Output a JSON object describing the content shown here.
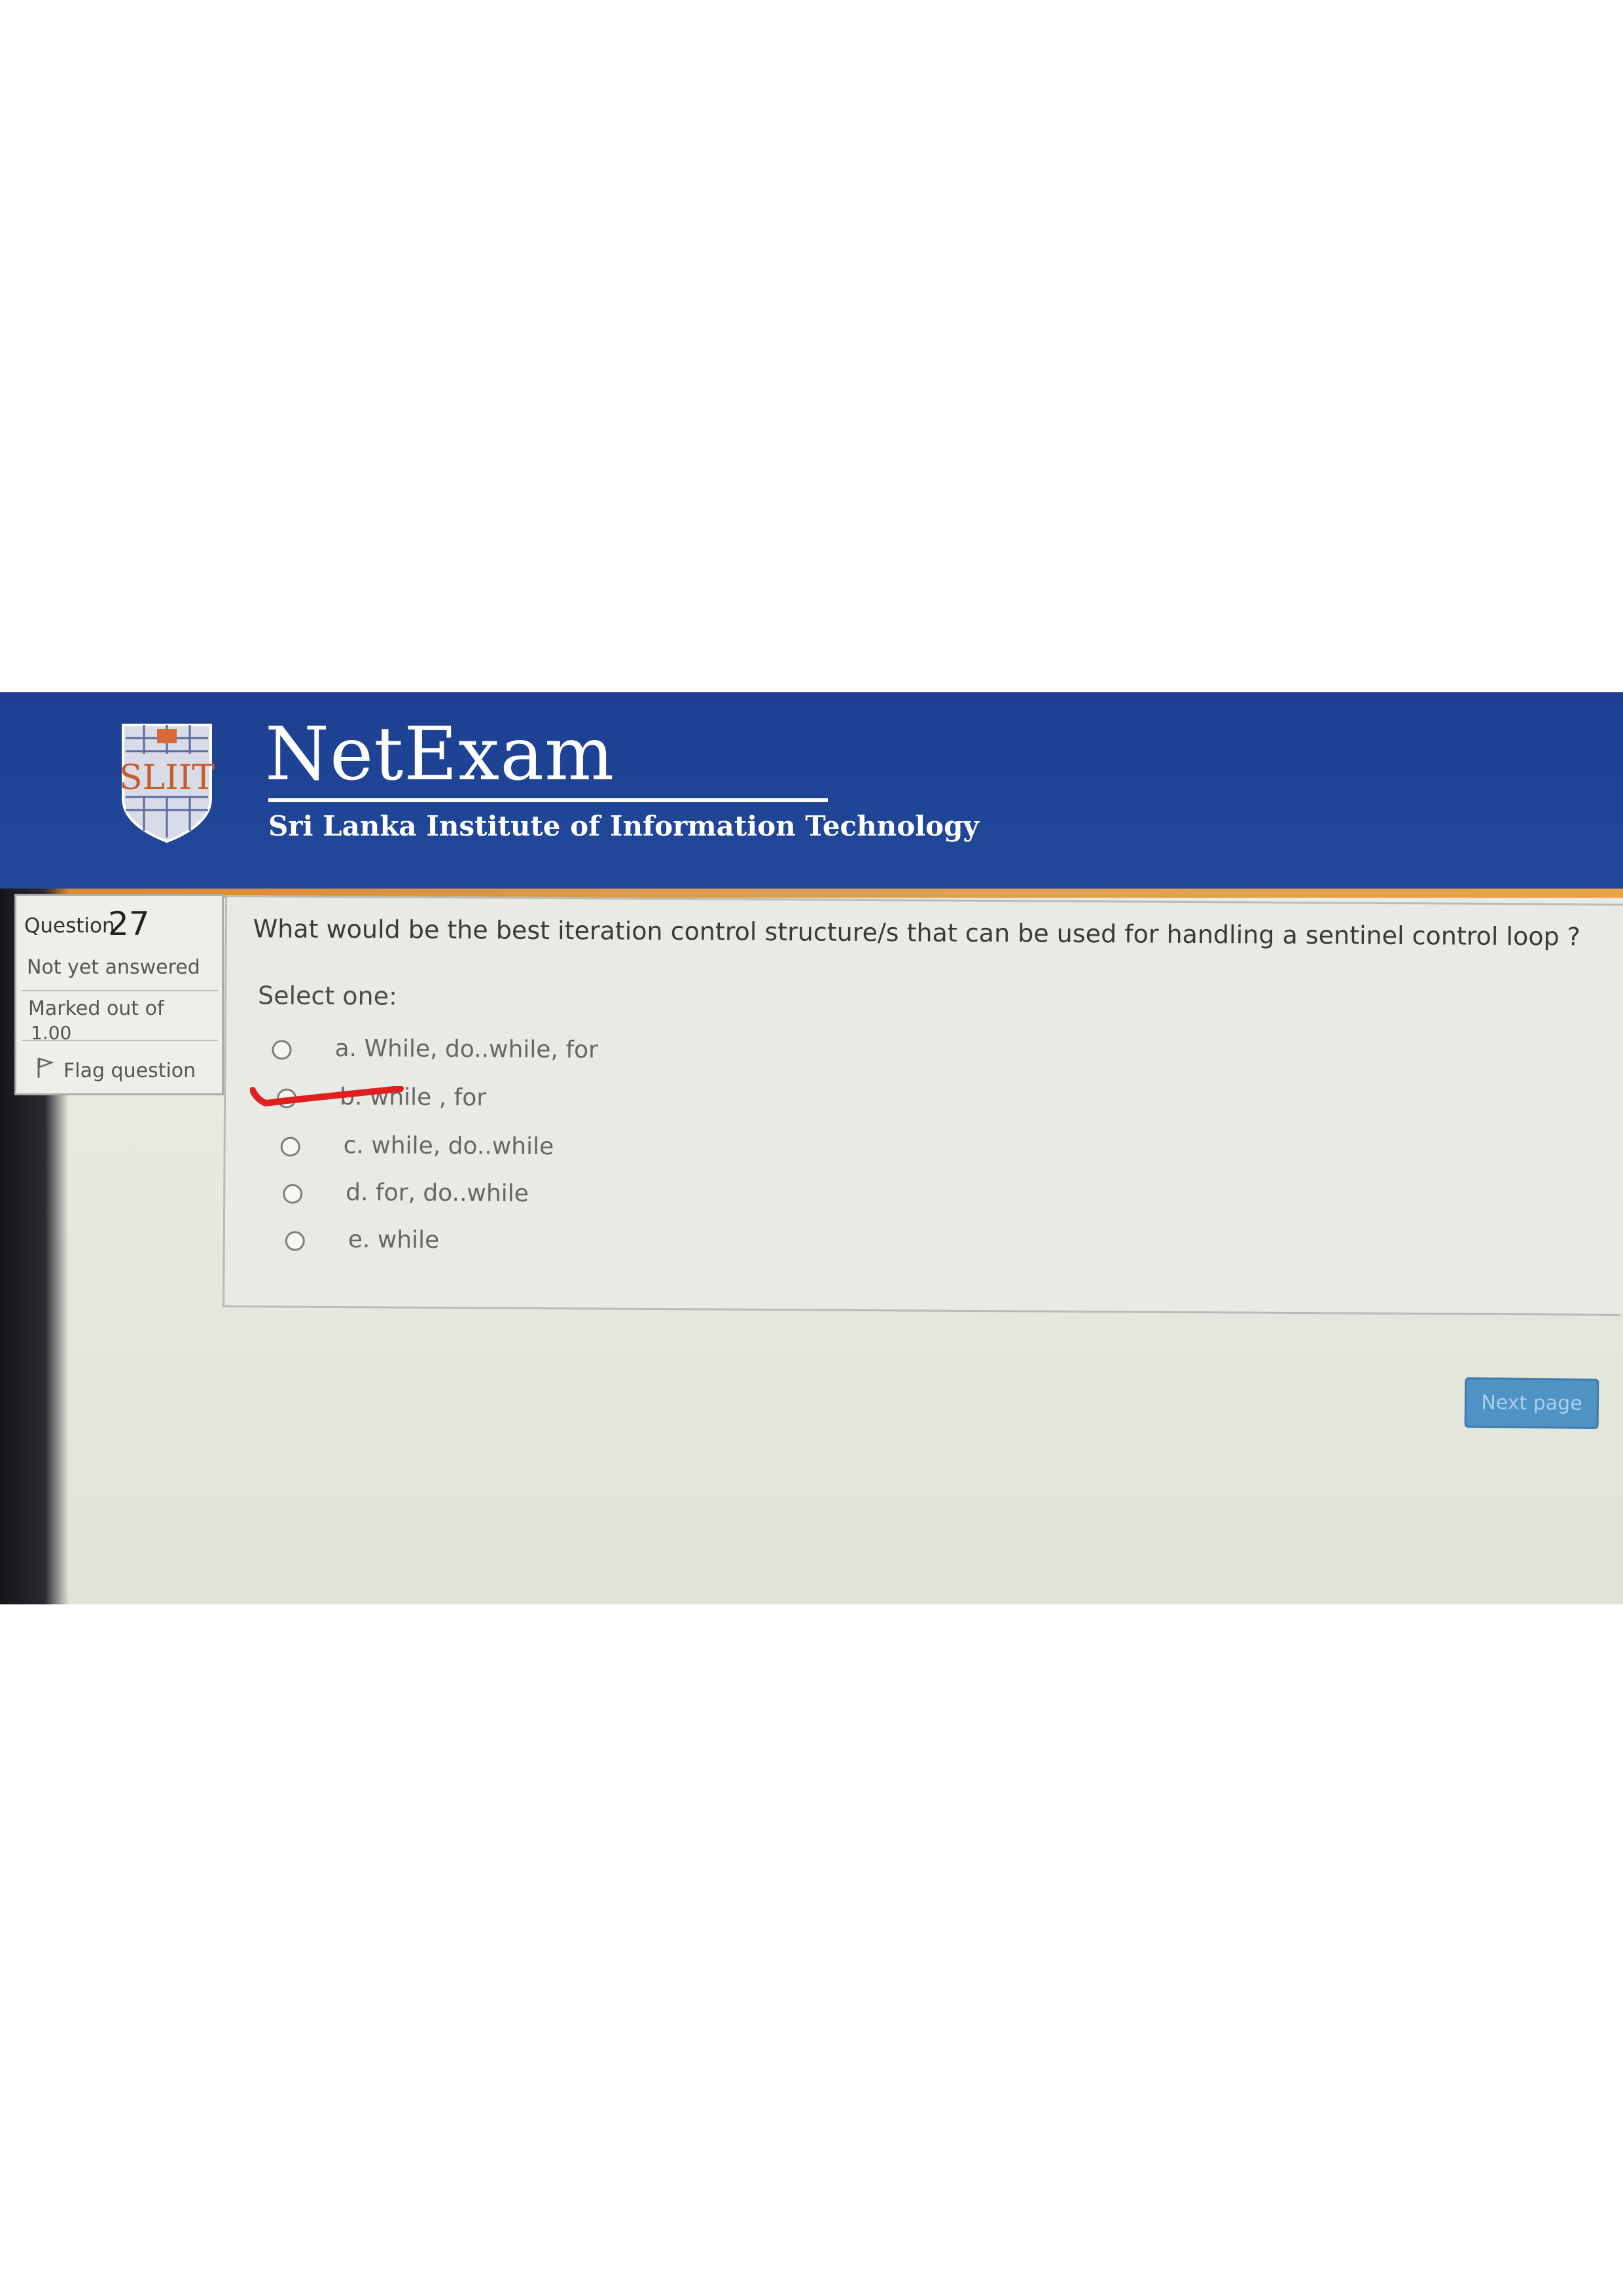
{
  "brand": {
    "title": "NetExam",
    "subtitle": "Sri Lanka Institute of Information Technology",
    "logo_text": "SLIIT"
  },
  "question_info": {
    "label": "Question",
    "number": "27",
    "status": "Not yet answered",
    "marked_label": "Marked out of",
    "marked_value": "1.00",
    "flag_label": "Flag question",
    "flag_icon": "flag-icon"
  },
  "question": {
    "text": "What would be the best iteration control structure/s that can be used for handling a sentinel control loop ?",
    "select_prompt": "Select one:",
    "options": [
      {
        "label": "a. While, do..while, for"
      },
      {
        "label": "b. while , for"
      },
      {
        "label": "c. while, do..while"
      },
      {
        "label": "d. for, do..while"
      },
      {
        "label": "e. while"
      }
    ]
  },
  "navigation": {
    "next_label": "Next page"
  },
  "colors": {
    "header_blue": "#1f4596",
    "accent_orange": "#e0872e",
    "annotation_red": "#e02020",
    "button_blue": "#4f93c5"
  }
}
